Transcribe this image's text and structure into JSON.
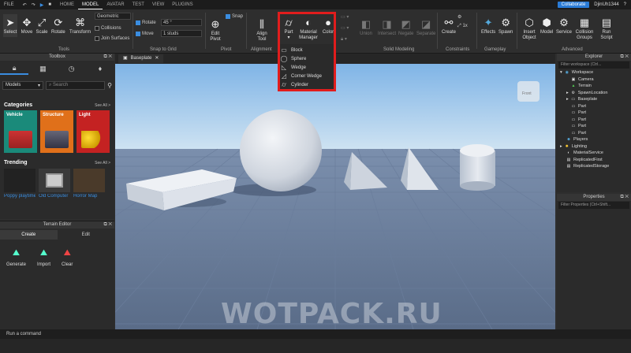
{
  "menubar": {
    "file": "FILE",
    "tabs": [
      "HOME",
      "MODEL",
      "AVATAR",
      "TEST",
      "VIEW",
      "PLUGINS"
    ],
    "active_tab": "MODEL",
    "collaborate": "Collaborate",
    "user": "DjinUh1344"
  },
  "ribbon": {
    "tools": {
      "select": "Select",
      "move": "Move",
      "scale": "Scale",
      "rotate": "Rotate",
      "transform": "Transform",
      "label": "Tools",
      "mode": "Geometric",
      "collisions": "Collisions",
      "join_surfaces": "Join Surfaces"
    },
    "snap": {
      "rotate": "Rotate",
      "rotate_val": "45 °",
      "move": "Move",
      "move_val": "1 studs",
      "label": "Snap to Grid"
    },
    "pivot": {
      "edit": "Edit Pivot",
      "snap": "Snap",
      "label": "Pivot"
    },
    "alignment": {
      "align": "Align Tool",
      "label": "Alignment"
    },
    "part": {
      "part": "Part",
      "material": "Material Manager",
      "color": "Color"
    },
    "solid": {
      "union": "Union",
      "intersect": "Intersect",
      "negate": "Negate",
      "separate": "Separate",
      "label": "Solid Modeling"
    },
    "constraints": {
      "create": "Create",
      "label": "Constraints"
    },
    "gameplay": {
      "effects": "Effects",
      "spawn": "Spawn",
      "label": "Gameplay"
    },
    "advanced": {
      "insert": "Insert Object",
      "model": "Model",
      "service": "Service",
      "collision": "Collision Groups",
      "run": "Run Script",
      "label": "Advanced"
    }
  },
  "part_menu": [
    "Block",
    "Sphere",
    "Wedge",
    "Corner Wedge",
    "Cylinder"
  ],
  "toolbox": {
    "title": "Toolbox",
    "category_select": "Models",
    "search_placeholder": "Search",
    "categories_title": "Categories",
    "see_all": "See All >",
    "categories": [
      "Vehicle",
      "Structure",
      "Light"
    ],
    "trending_title": "Trending",
    "trending": [
      "Poppy playtime 3...",
      "Old Computer",
      "Horror Map"
    ]
  },
  "terrain": {
    "title": "Terrain Editor",
    "tabs": [
      "Create",
      "Edit"
    ],
    "tools": [
      "Generate",
      "Import",
      "Clear"
    ]
  },
  "viewport": {
    "tab": "Baseplate",
    "camera_face": "Front"
  },
  "explorer": {
    "title": "Explorer",
    "filter": "Filter workspace (Ctrl...",
    "items": [
      "Workspace",
      "Camera",
      "Terrain",
      "SpawnLocation",
      "Baseplate",
      "Part",
      "Part",
      "Part",
      "Part",
      "Part",
      "Players",
      "Lighting",
      "MaterialService",
      "ReplicatedFirst",
      "ReplicatedStorage"
    ]
  },
  "properties": {
    "title": "Properties",
    "filter": "Filter Properties (Ctrl+Shift..."
  },
  "command": {
    "placeholder": "Run a command"
  },
  "watermark": "WOTPACK.RU"
}
